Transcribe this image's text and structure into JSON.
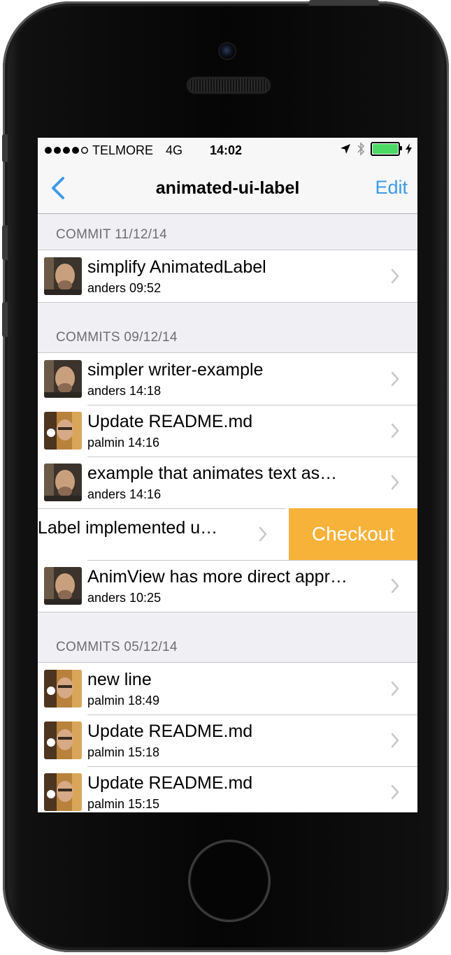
{
  "statusbar": {
    "carrier": "TELMORE",
    "network": "4G",
    "time": "14:02",
    "battery_level": 1.0,
    "icons": [
      "location-arrow-icon",
      "bluetooth-icon",
      "battery-icon",
      "charging-bolt-icon"
    ]
  },
  "navbar": {
    "title": "animated-ui-label",
    "edit_label": "Edit",
    "back_icon": "chevron-left-icon"
  },
  "accent_color": "#3d9be9",
  "checkout_color": "#f7b23a",
  "sections": [
    {
      "header": "COMMIT 11/12/14",
      "rows": [
        {
          "message": "simplify AnimatedLabel",
          "meta": "anders 09:52",
          "avatar": "anders"
        }
      ]
    },
    {
      "header": "COMMITS 09/12/14",
      "rows": [
        {
          "message": "simpler writer-example",
          "meta": "anders 14:18",
          "avatar": "anders"
        },
        {
          "message": "Update README.md",
          "meta": "palmin 14:16",
          "avatar": "palmin"
        },
        {
          "message": "example that animates text as…",
          "meta": "anders 14:16",
          "avatar": "anders"
        },
        {
          "message": "Label implemented u…",
          "meta": "",
          "avatar": "",
          "swiped": true,
          "action_label": "Checkout"
        },
        {
          "message": "AnimView has more direct appr…",
          "meta": "anders 10:25",
          "avatar": "anders"
        }
      ]
    },
    {
      "header": "COMMITS 05/12/14",
      "rows": [
        {
          "message": "new line",
          "meta": "palmin 18:49",
          "avatar": "palmin"
        },
        {
          "message": "Update README.md",
          "meta": "palmin 15:18",
          "avatar": "palmin"
        },
        {
          "message": "Update README.md",
          "meta": "palmin 15:15",
          "avatar": "palmin"
        }
      ]
    }
  ]
}
